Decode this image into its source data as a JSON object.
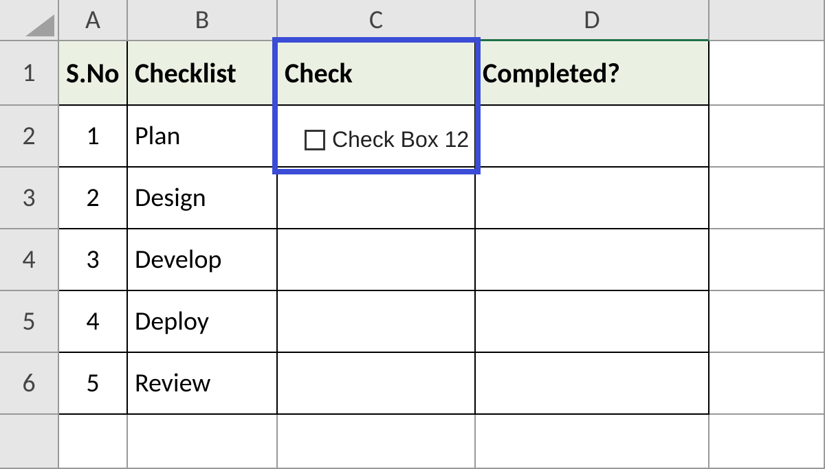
{
  "columns": {
    "A": "A",
    "B": "B",
    "C": "C",
    "D": "D"
  },
  "rows": {
    "r1": "1",
    "r2": "2",
    "r3": "3",
    "r4": "4",
    "r5": "5",
    "r6": "6"
  },
  "headers": {
    "sno": "S.No",
    "checklist": "Checklist",
    "check": "Check",
    "completed": "Completed?"
  },
  "data": {
    "row2": {
      "sno": "1",
      "checklist": "Plan"
    },
    "row3": {
      "sno": "2",
      "checklist": "Design"
    },
    "row4": {
      "sno": "3",
      "checklist": "Develop"
    },
    "row5": {
      "sno": "4",
      "checklist": "Deploy"
    },
    "row6": {
      "sno": "5",
      "checklist": "Review"
    }
  },
  "checkbox": {
    "label": "Check Box 12",
    "checked": false
  },
  "colors": {
    "highlight": "#3b4cd6",
    "headerBg": "#eaf1e3",
    "grayBg": "#e6e6e6",
    "selectedCol": "#1e7145"
  }
}
